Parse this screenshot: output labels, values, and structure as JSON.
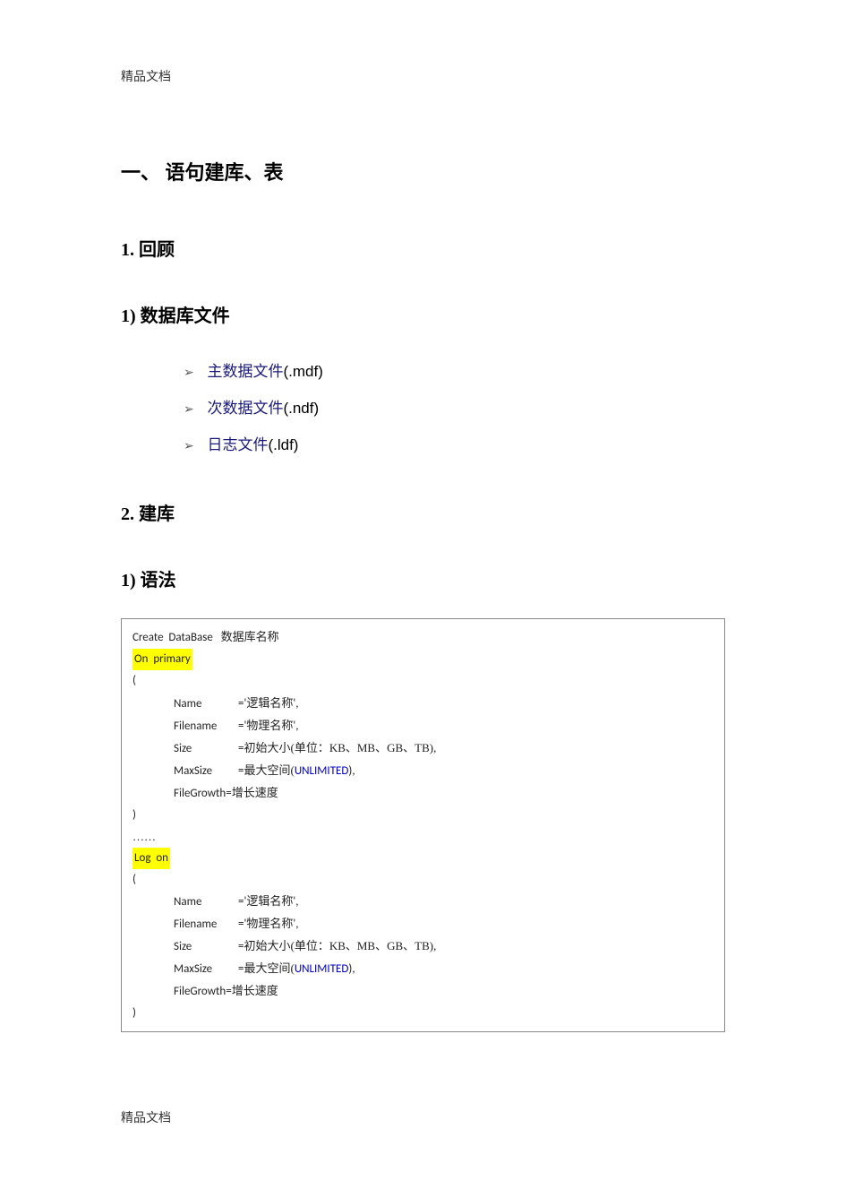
{
  "header": {
    "label": "精品文档"
  },
  "footer": {
    "label": "精品文档"
  },
  "heading_main": "一、  语句建库、表",
  "section1": {
    "num": "1.  回顾",
    "sub_num": "1)  数据库文件",
    "bullets": [
      {
        "prefix_zh": "主数据文件",
        "suffix": "(.mdf)"
      },
      {
        "prefix_zh": "次数据文件",
        "suffix": "(.ndf)"
      },
      {
        "prefix_zh": "日志文件",
        "suffix": "(.ldf)"
      }
    ]
  },
  "section2": {
    "num": "2.  建库",
    "sub_num": "1)  语法"
  },
  "code": {
    "l1_a": "Create  DataBase",
    "l1_b": "数据库名称",
    "l2": "On  primary",
    "l3": "(",
    "name_label": "Name",
    "name_eq": "='",
    "name_val": "逻辑名称",
    "name_post": "',",
    "filename_label": "Filename",
    "filename_eq": "='",
    "filename_val": "物理名称",
    "filename_post": "',",
    "size_label": "Size",
    "size_eq": "=",
    "size_val": "初始大小(单位：KB、MB、GB、TB),",
    "maxsize_label": "MaxSize",
    "maxsize_eq": "=",
    "maxsize_val_a": "最大空间(",
    "maxsize_kw": "UNLIMITED",
    "maxsize_val_b": "),",
    "filegrowth_label": "FileGrowth=",
    "filegrowth_val": "增长速度",
    "close_paren": ")",
    "dots": "……",
    "log_on": "Log  on",
    "open_paren2": "("
  }
}
